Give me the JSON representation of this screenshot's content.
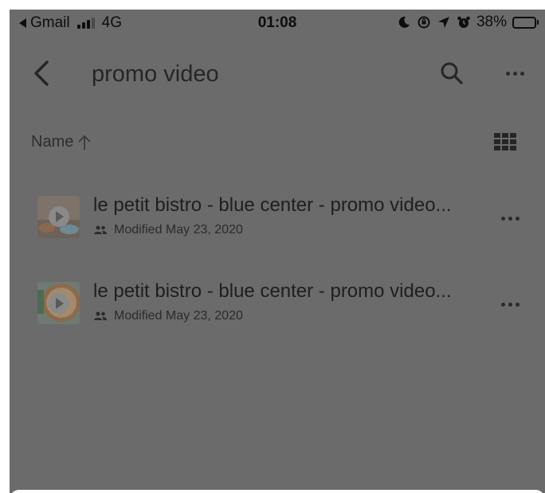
{
  "status_bar": {
    "back_app": "Gmail",
    "network": "4G",
    "time": "01:08",
    "battery_percent": "38%",
    "battery_level": 0.38,
    "battery_color": "#f2c200",
    "icons": [
      "moon-icon",
      "rotation-lock-icon",
      "location-arrow-icon",
      "alarm-icon"
    ]
  },
  "header": {
    "query": "promo video",
    "back_icon": "chevron-left-icon",
    "search_icon": "search-icon",
    "more_icon": "more-horizontal-icon"
  },
  "sort": {
    "label": "Name",
    "direction_icon": "arrow-up-icon",
    "view_toggle_icon": "grid-view-icon"
  },
  "files": [
    {
      "name": "le petit bistro - blue center - promo video...",
      "shared_icon": "people-icon",
      "modified": "Modified May 23, 2020",
      "thumb_icon": "video-play-icon"
    },
    {
      "name": "le petit bistro - blue center - promo video...",
      "shared_icon": "people-icon",
      "modified": "Modified May 23, 2020",
      "thumb_icon": "video-play-icon"
    }
  ],
  "colors": {
    "overlay": "#6b6b6b",
    "sheet": "#ffffff"
  }
}
